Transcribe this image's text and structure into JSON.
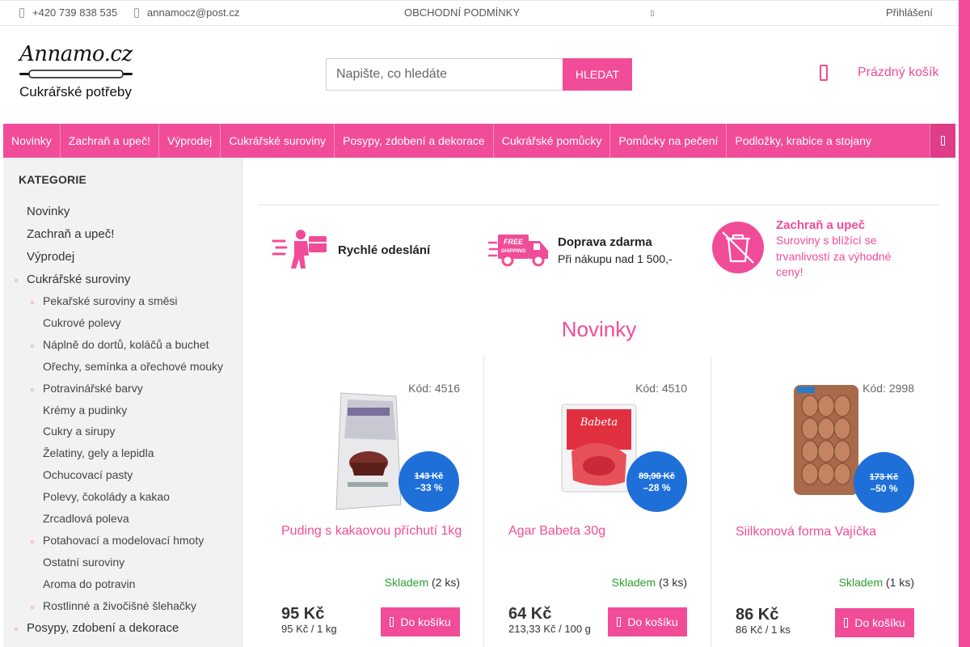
{
  "topbar": {
    "phone": "+420 739 838 535",
    "email": "annamocz@post.cz",
    "terms": "OBCHODNÍ PODMÍNKY",
    "login": "Přihlášení"
  },
  "header": {
    "logo_script": "Annamo.cz",
    "logo_sub": "Cukrářské potřeby",
    "search_placeholder": "Napište, co hledáte",
    "search_button": "HLEDAT",
    "cart_label": "Prázdný košík"
  },
  "nav": {
    "items": [
      "Novinky",
      "Zachraň a upeč!",
      "Výprodej",
      "Cukrářské suroviny",
      "Posypy, zdobení a dekorace",
      "Cukrářské pomůcky",
      "Pomůcky na pečení",
      "Podložky, krabice a stojany"
    ]
  },
  "sidebar": {
    "title": "KATEGORIE",
    "items": [
      {
        "label": "Novinky",
        "level": 1
      },
      {
        "label": "Zachraň a upeč!",
        "level": 1
      },
      {
        "label": "Výprodej",
        "level": 1
      },
      {
        "label": "Cukrářské suroviny",
        "level": 1
      },
      {
        "label": "Pekařské suroviny a směsi",
        "level": 2
      },
      {
        "label": "Cukrové polevy",
        "level": 2
      },
      {
        "label": "Náplně do dortů, koláčů a buchet",
        "level": 2
      },
      {
        "label": "Ořechy, semínka a ořechové mouky",
        "level": 2
      },
      {
        "label": "Potravinářské barvy",
        "level": 2
      },
      {
        "label": "Krémy a pudinky",
        "level": 2
      },
      {
        "label": "Cukry a sirupy",
        "level": 2
      },
      {
        "label": "Želatiny, gely a lepidla",
        "level": 2
      },
      {
        "label": "Ochucovací pasty",
        "level": 2
      },
      {
        "label": "Polevy, čokolády a kakao",
        "level": 2
      },
      {
        "label": "Zrcadlová poleva",
        "level": 2
      },
      {
        "label": "Potahovací a modelovací hmoty",
        "level": 2
      },
      {
        "label": "Ostatní suroviny",
        "level": 2
      },
      {
        "label": "Aroma do potravin",
        "level": 2
      },
      {
        "label": "Rostlinné a živočišné šlehačky",
        "level": 2
      },
      {
        "label": "Posypy, zdobení a dekorace",
        "level": 1
      }
    ]
  },
  "benefits": {
    "b1_title": "Rychlé odeslání",
    "b2_title": "Doprava zdarma",
    "b2_text": "Při nákupu nad 1 500,-",
    "b3_title": "Zachraň a upeč",
    "b3_text": "Suroviny s blížící se trvanlivostí za výhodné ceny!",
    "free_badge_top": "FREE",
    "free_badge_bottom": "SHIPPING"
  },
  "section": {
    "title": "Novinky"
  },
  "products": [
    {
      "code": "Kód: 4516",
      "name": "Puding s kakaovou příchutí 1kg",
      "old_price": "143 Kč",
      "discount": "–33 %",
      "stock_status": "Skladem",
      "stock_count": "(2 ks)",
      "price": "95 Kč",
      "unit_price": "95 Kč / 1 kg",
      "button": "Do košíku"
    },
    {
      "code": "Kód: 4510",
      "name": "Agar Babeta 30g",
      "old_price": "89,90 Kč",
      "discount": "–28 %",
      "stock_status": "Skladem",
      "stock_count": "(3 ks)",
      "price": "64 Kč",
      "unit_price": "213,33 Kč / 100 g",
      "button": "Do košíku"
    },
    {
      "code": "Kód: 2998",
      "name": "Siilkonová forma Vajíčka",
      "old_price": "173 Kč",
      "discount": "–50 %",
      "stock_status": "Skladem",
      "stock_count": "(1 ks)",
      "price": "86 Kč",
      "unit_price": "86 Kč / 1 ks",
      "button": "Do košíku"
    }
  ],
  "colors": {
    "accent": "#f14c97",
    "badge": "#1f6fd9",
    "stock": "#2e9e2e"
  }
}
